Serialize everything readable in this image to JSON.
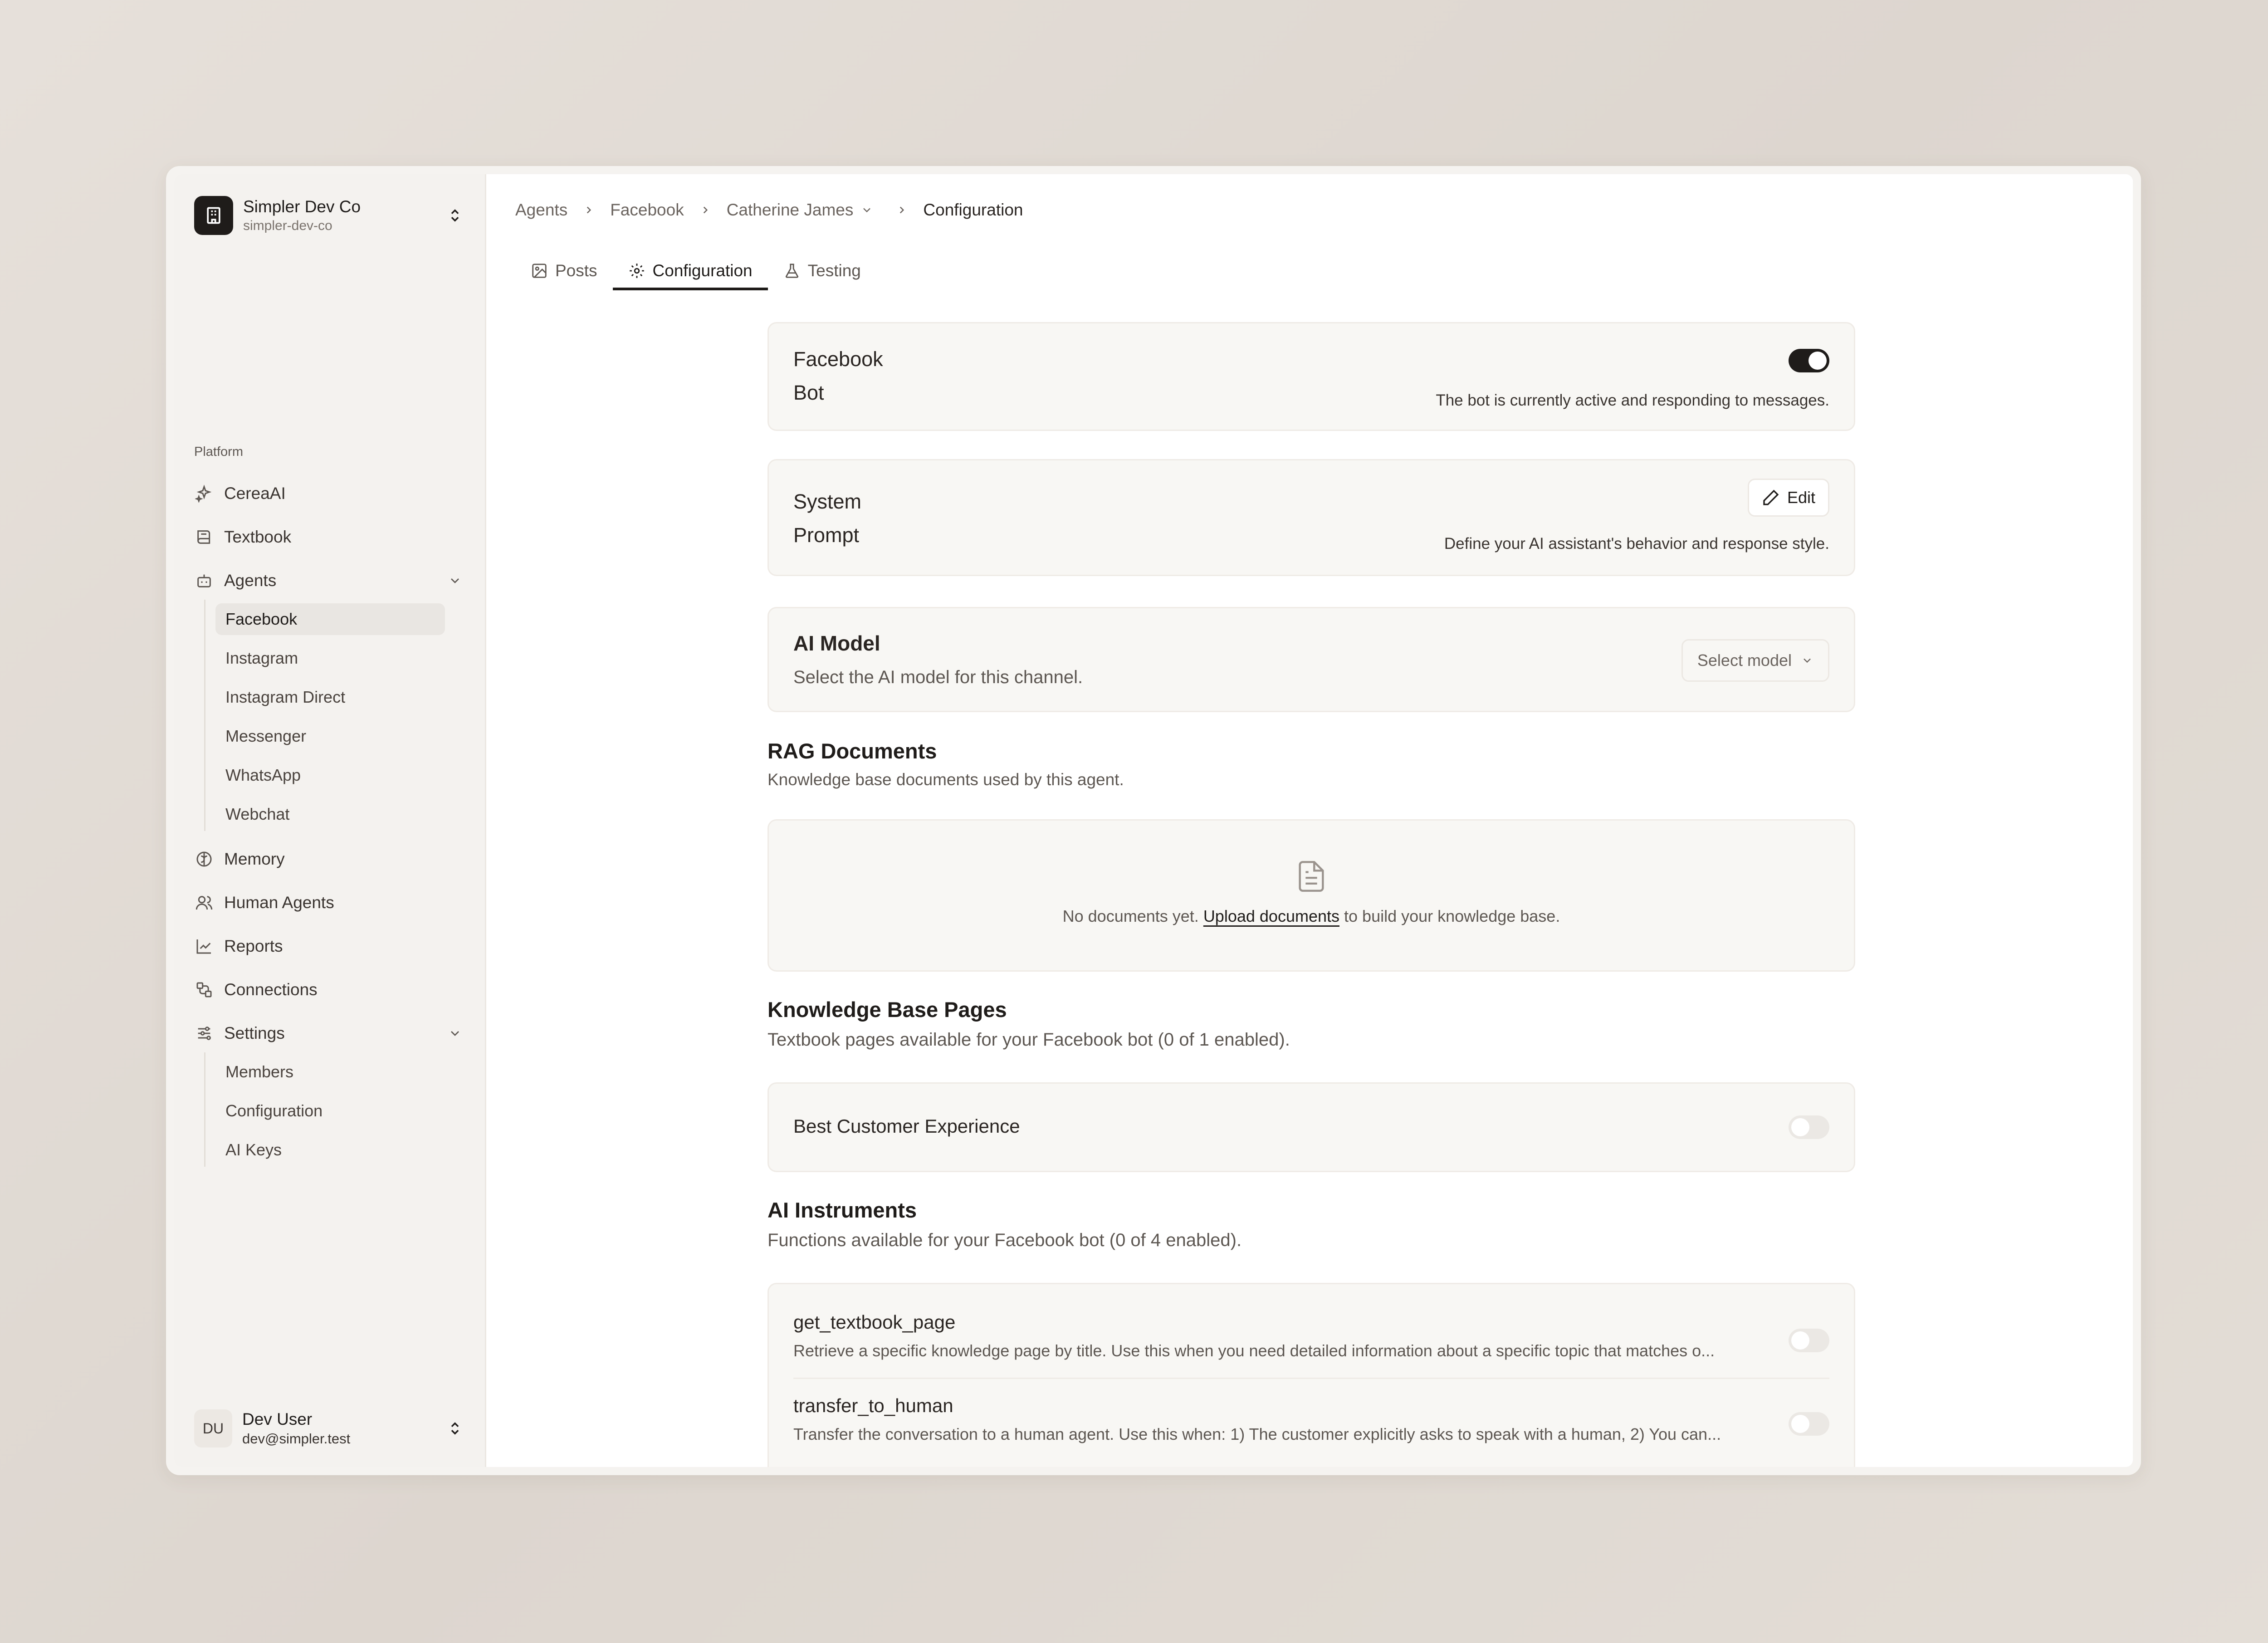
{
  "org": {
    "name": "Simpler Dev Co",
    "slug": "simpler-dev-co"
  },
  "sidebar": {
    "section_label": "Platform",
    "items": [
      {
        "label": "CereaAI",
        "icon": "sparkles-icon"
      },
      {
        "label": "Textbook",
        "icon": "book-icon"
      },
      {
        "label": "Agents",
        "icon": "bot-icon"
      },
      {
        "label": "Memory",
        "icon": "brain-icon"
      },
      {
        "label": "Human Agents",
        "icon": "users-icon"
      },
      {
        "label": "Reports",
        "icon": "chart-icon"
      },
      {
        "label": "Connections",
        "icon": "connection-icon"
      },
      {
        "label": "Settings",
        "icon": "sliders-icon"
      }
    ],
    "agents_sub": [
      "Facebook",
      "Instagram",
      "Instagram Direct",
      "Messenger",
      "WhatsApp",
      "Webchat"
    ],
    "settings_sub": [
      "Members",
      "Configuration",
      "AI Keys"
    ]
  },
  "user": {
    "initials": "DU",
    "name": "Dev User",
    "email": "dev@simpler.test"
  },
  "breadcrumb": [
    "Agents",
    "Facebook",
    "Catherine James",
    "Configuration"
  ],
  "tabs": [
    "Posts",
    "Configuration",
    "Testing"
  ],
  "facebook_bot": {
    "title_line1": "Facebook",
    "title_line2": "Bot",
    "description": "The bot is currently active and responding to messages.",
    "enabled": true
  },
  "system_prompt": {
    "title_line1": "System",
    "title_line2": "Prompt",
    "edit_label": "Edit",
    "description": "Define your AI assistant's behavior and response style."
  },
  "ai_model": {
    "title": "AI Model",
    "description": "Select the AI model for this channel.",
    "select_placeholder": "Select model"
  },
  "rag": {
    "title": "RAG Documents",
    "description": "Knowledge base documents used by this agent.",
    "empty_prefix": "No documents yet.",
    "empty_link": "Upload documents",
    "empty_suffix": "to build your knowledge base."
  },
  "kb_pages": {
    "title": "Knowledge Base Pages",
    "description": "Textbook pages available for your Facebook bot (0 of 1 enabled).",
    "items": [
      {
        "label": "Best Customer Experience",
        "enabled": false
      }
    ]
  },
  "instruments": {
    "title": "AI Instruments",
    "description": "Functions available for your Facebook bot (0 of 4 enabled).",
    "items": [
      {
        "name": "get_textbook_page",
        "description": "Retrieve a specific knowledge page by title. Use this when you need detailed information about a specific topic that matches o...",
        "enabled": false
      },
      {
        "name": "transfer_to_human",
        "description": "Transfer the conversation to a human agent. Use this when: 1) The customer explicitly asks to speak with a human, 2) You can...",
        "enabled": false
      }
    ]
  }
}
